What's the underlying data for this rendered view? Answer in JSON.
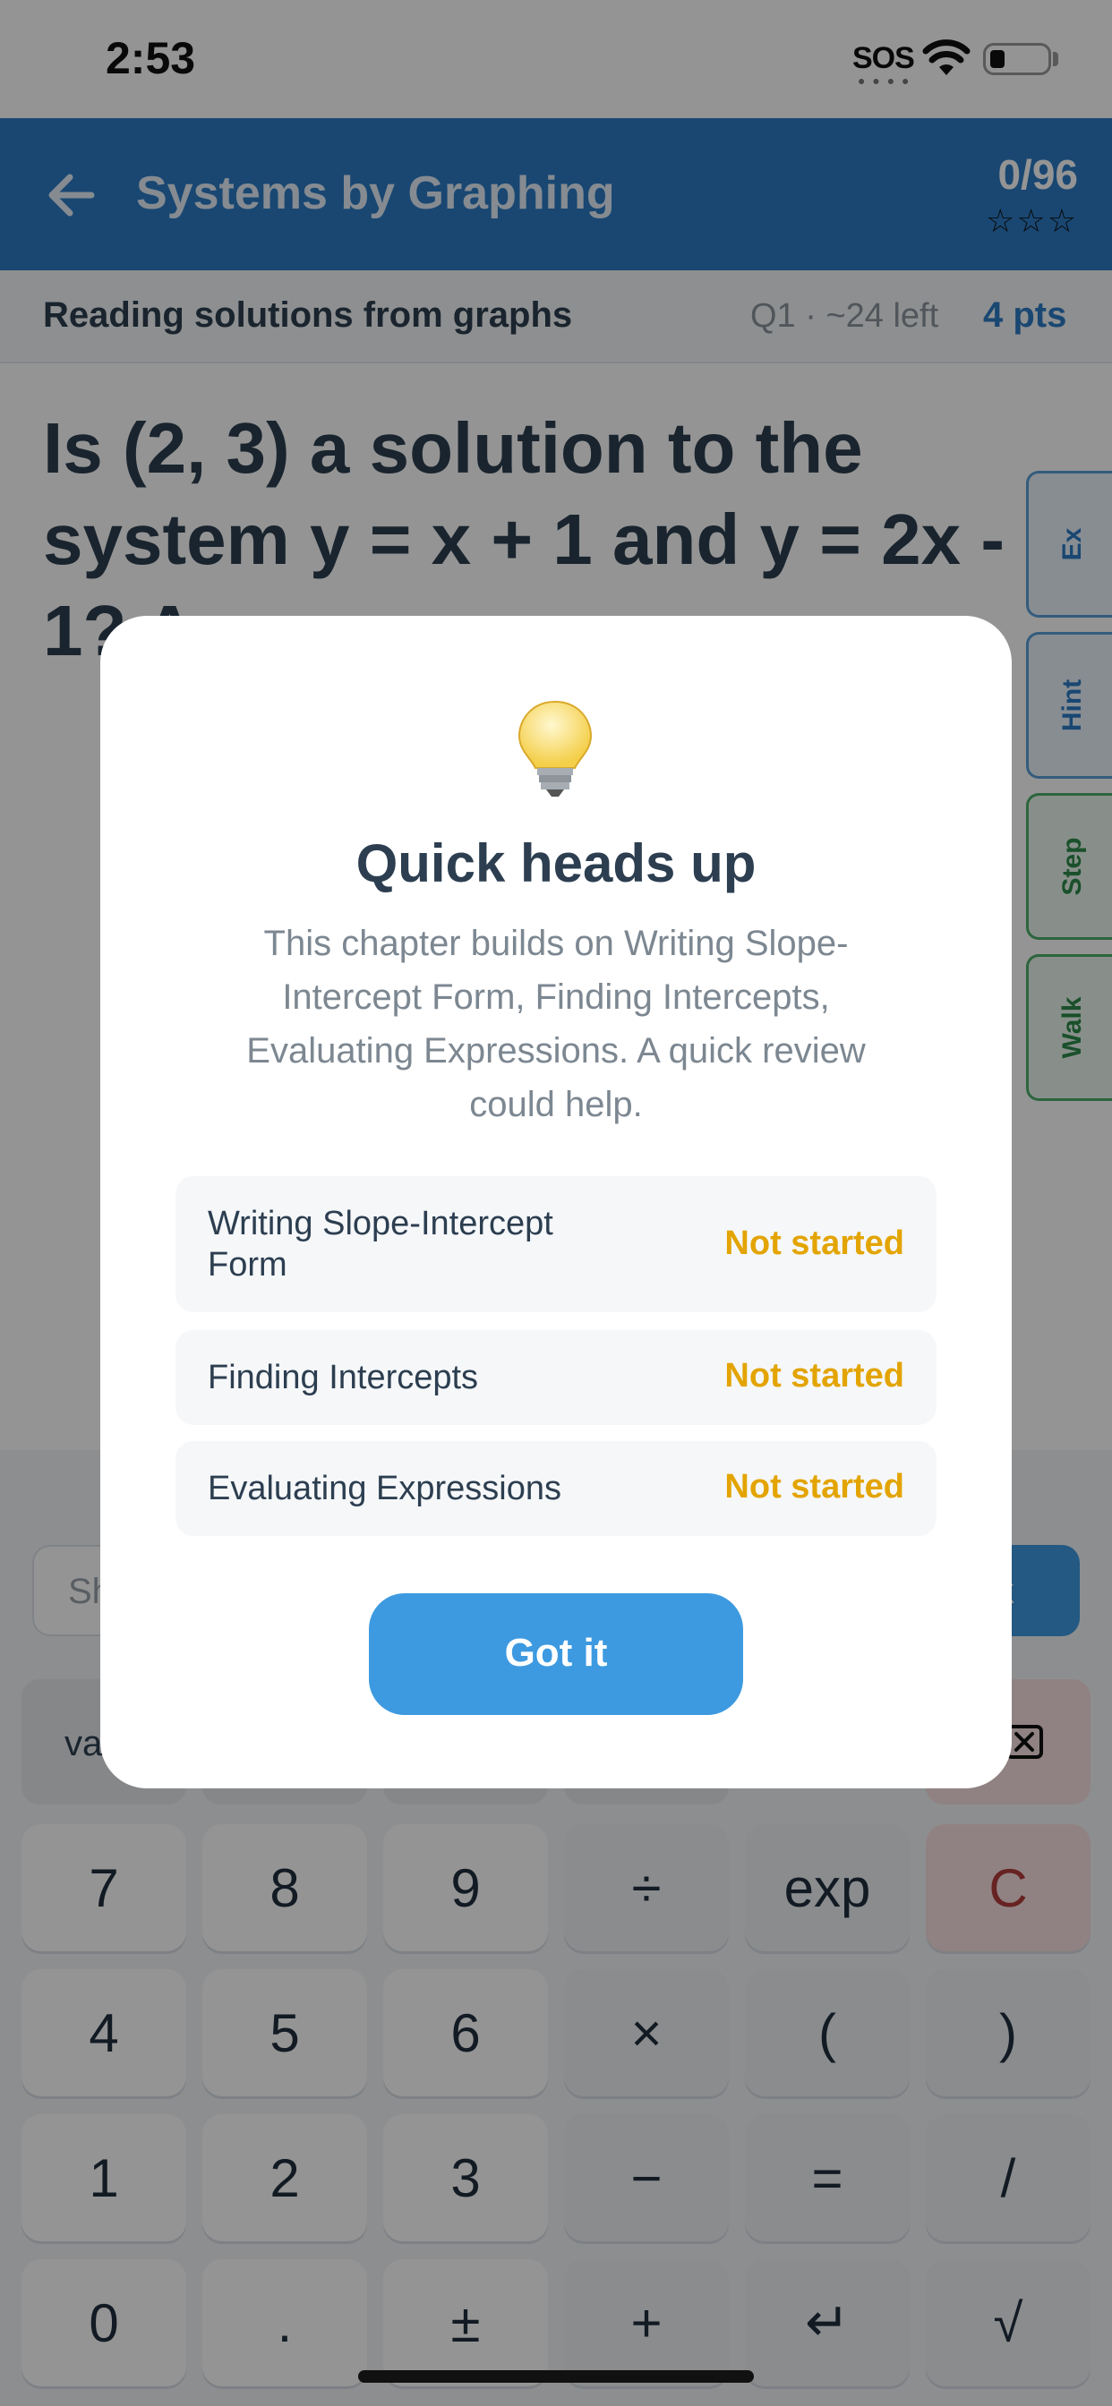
{
  "status_bar": {
    "time": "2:53",
    "carrier": "SOS"
  },
  "header": {
    "title": "Systems by Graphing",
    "score": "0/96",
    "stars": "☆☆☆"
  },
  "sub_header": {
    "topic": "Reading solutions from graphs",
    "question_meta": "Q1 · ~24 left",
    "points": "4 pts"
  },
  "question": {
    "text": "Is (2, 3) a solution to the system y = x + 1 and y = 2x - 1? A"
  },
  "side_tabs": {
    "ex": "Ex",
    "hint": "Hint",
    "step": "Step",
    "walk": "Walk"
  },
  "answer": {
    "placeholder": "Sh",
    "check_label": "ck"
  },
  "keyboard": {
    "var_label": "va",
    "rows": [
      [
        "7",
        "8",
        "9",
        "÷",
        "exp",
        "C"
      ],
      [
        "4",
        "5",
        "6",
        "×",
        "(",
        ")"
      ],
      [
        "1",
        "2",
        "3",
        "−",
        "=",
        "/"
      ],
      [
        "0",
        ".",
        "±",
        "+",
        "↵",
        "√"
      ]
    ]
  },
  "modal": {
    "icon": "lightbulb-icon",
    "title": "Quick heads up",
    "body": "This chapter builds on Writing Slope-Intercept Form, Finding Intercepts, Evaluating Expressions. A quick review could help.",
    "chapters": [
      {
        "name": "Writing Slope-Intercept Form",
        "status": "Not started"
      },
      {
        "name": "Finding Intercepts",
        "status": "Not started"
      },
      {
        "name": "Evaluating Expressions",
        "status": "Not started"
      }
    ],
    "button": "Got it"
  },
  "colors": {
    "accent": "#3d9ae0",
    "header": "#2b7bc5",
    "status_pending": "#e3a400"
  }
}
